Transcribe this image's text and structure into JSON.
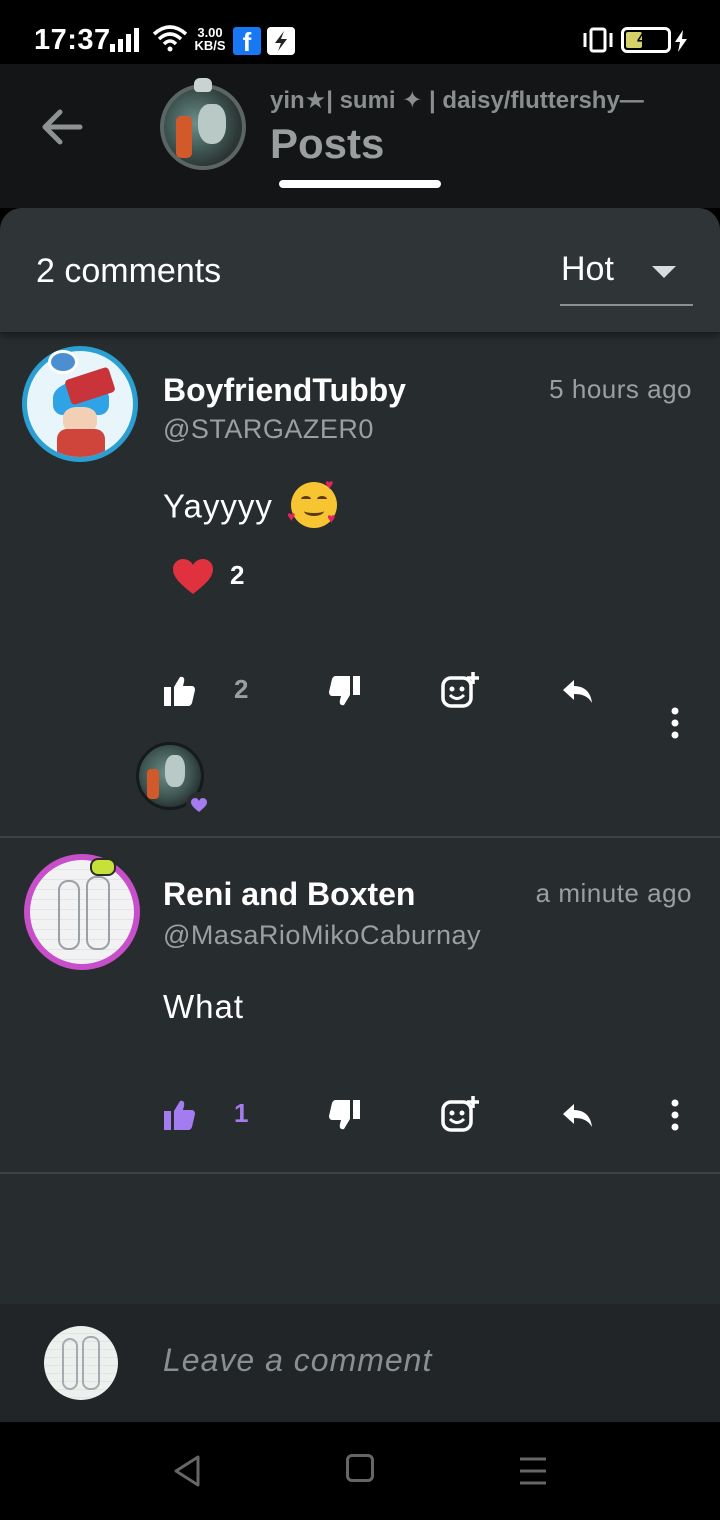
{
  "status_bar": {
    "time": "17:37",
    "speed_value": "3.00",
    "speed_unit": "KB/S",
    "battery_level": "40",
    "battery_fraction": 0.4
  },
  "header": {
    "subtitle": "yin★| sumi ✦ | daisy/fluttershy—",
    "title": "Posts"
  },
  "comments_header": {
    "count_label": "2 comments",
    "sort_value": "Hot"
  },
  "comments": [
    {
      "name": "BoyfriendTubby",
      "handle": "@STARGAZER0",
      "time": "5 hours ago",
      "body": "Yayyyy",
      "emoji": "smiling-face-with-hearts",
      "reaction_count": "2",
      "like_count": "2",
      "liked": false
    },
    {
      "name": "Reni and Boxten",
      "handle": "@MasaRioMikoCaburnay",
      "time": "a minute ago",
      "body": "What",
      "like_count": "1",
      "liked": true
    }
  ],
  "composer": {
    "placeholder": "Leave a comment"
  },
  "colors": {
    "accent_purple": "#a57cf0",
    "heart_red": "#e0313e",
    "panel": "#272c2e"
  }
}
